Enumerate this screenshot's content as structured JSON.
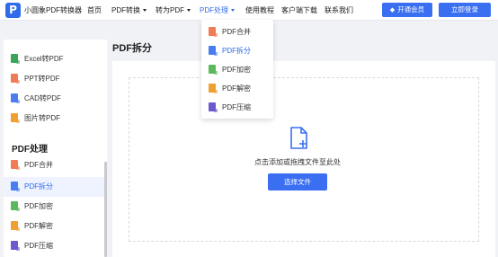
{
  "header": {
    "logo_letter": "P",
    "brand": "小圆象PDF转换器",
    "nav": [
      {
        "label": "首页",
        "has_caret": false,
        "active": false
      },
      {
        "label": "PDF转换",
        "has_caret": true,
        "active": false
      },
      {
        "label": "转为PDF",
        "has_caret": true,
        "active": false
      },
      {
        "label": "PDF处理",
        "has_caret": true,
        "active": true
      },
      {
        "label": "使用教程",
        "has_caret": false,
        "active": false
      },
      {
        "label": "客户端下载",
        "has_caret": false,
        "active": false
      },
      {
        "label": "联系我们",
        "has_caret": false,
        "active": false
      }
    ],
    "vip_button": "开通会员",
    "login_button": "立即登录"
  },
  "dropdown": {
    "items": [
      {
        "label": "PDF合并",
        "icon": "merge-icon",
        "color": "#f07c55",
        "active": false
      },
      {
        "label": "PDF拆分",
        "icon": "split-icon",
        "color": "#4a7ef0",
        "active": true
      },
      {
        "label": "PDF加密",
        "icon": "encrypt-icon",
        "color": "#5cb85c",
        "active": false
      },
      {
        "label": "PDF解密",
        "icon": "decrypt-icon",
        "color": "#f0a030",
        "active": false
      },
      {
        "label": "PDF压缩",
        "icon": "compress-icon",
        "color": "#6a5acd",
        "active": false
      }
    ]
  },
  "sidebar": {
    "convert_items": [
      {
        "label": "Excel转PDF",
        "icon": "excel-icon",
        "color": "#3aa55a"
      },
      {
        "label": "PPT转PDF",
        "icon": "ppt-icon",
        "color": "#f07c55"
      },
      {
        "label": "CAD转PDF",
        "icon": "cad-icon",
        "color": "#4a7ef0"
      },
      {
        "label": "图片转PDF",
        "icon": "image-icon",
        "color": "#f0a030"
      }
    ],
    "section_title": "PDF处理",
    "process_items": [
      {
        "label": "PDF合并",
        "icon": "merge-icon",
        "color": "#f07c55",
        "active": false
      },
      {
        "label": "PDF拆分",
        "icon": "split-icon",
        "color": "#4a7ef0",
        "active": true
      },
      {
        "label": "PDF加密",
        "icon": "encrypt-icon",
        "color": "#5cb85c",
        "active": false
      },
      {
        "label": "PDF解密",
        "icon": "decrypt-icon",
        "color": "#f0a030",
        "active": false
      },
      {
        "label": "PDF压缩",
        "icon": "compress-icon",
        "color": "#6a5acd",
        "active": false
      }
    ]
  },
  "main": {
    "title": "PDF拆分",
    "drop_text": "点击添加或拖拽文件至此处",
    "choose_button": "选择文件",
    "accent_color": "#3a6ff2"
  }
}
